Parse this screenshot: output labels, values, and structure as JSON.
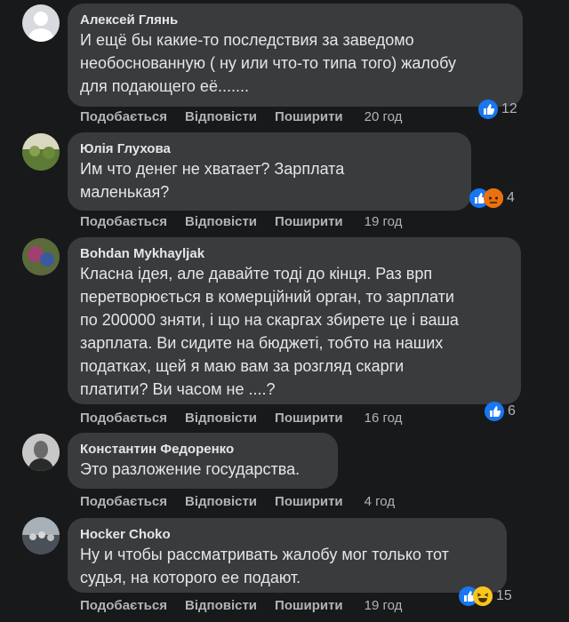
{
  "comments": [
    {
      "author": "Алексей Глянь",
      "text": "И ещё бы какие-то последствия за заведомо\nнеобоснованную ( ну или что-то типа того) жалобу\nдля подающего её.......",
      "like": "Подобається",
      "reply": "Відповісти",
      "share": "Поширити",
      "time": "20 год",
      "reaction_count": "12",
      "reactions": [
        "like-icon"
      ]
    },
    {
      "author": "Юлія Глухова",
      "text": "Им что денег не хватает? Зарплата\nмаленькая?",
      "like": "Подобається",
      "reply": "Відповісти",
      "share": "Поширити",
      "time": "19 год",
      "reaction_count": "4",
      "reactions": [
        "like-icon",
        "angry-icon"
      ]
    },
    {
      "author": "Bohdan Mykhayljak",
      "text": "Класна ідея, але давайте тоді до кінця. Раз врп\nперетворюється в комерційний орган, то зарплати\nпо 200000 зняти, і що на скаргах збирете це і ваша\nзарплата. Ви сидите на бюджеті, тобто на наших\nподатках, щей я маю вам за розгляд скарги\nплатити? Ви часом не ....?",
      "like": "Подобається",
      "reply": "Відповісти",
      "share": "Поширити",
      "time": "16 год",
      "reaction_count": "6",
      "reactions": [
        "like-icon"
      ]
    },
    {
      "author": "Константин Федоренко",
      "text": "Это разложение государства.",
      "like": "Подобається",
      "reply": "Відповісти",
      "share": "Поширити",
      "time": "4 год",
      "reaction_count": "",
      "reactions": []
    },
    {
      "author": "Hocker Choko",
      "text": "Ну и чтобы рассматривать жалобу мог только тот\nсудья, на которого ее подают.",
      "like": "Подобається",
      "reply": "Відповісти",
      "share": "Поширити",
      "time": "19 год",
      "reaction_count": "15",
      "reactions": [
        "like-icon",
        "haha-icon"
      ]
    }
  ]
}
